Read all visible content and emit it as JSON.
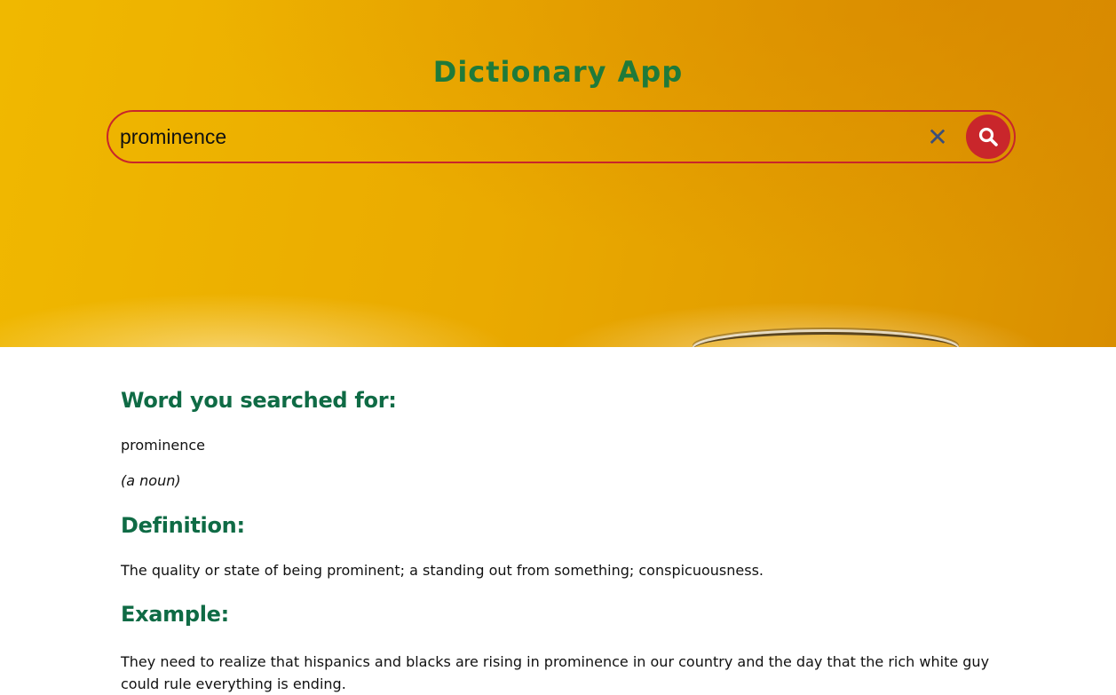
{
  "app": {
    "title": "Dictionary App"
  },
  "search": {
    "value": "prominence",
    "clear_icon": "close-icon",
    "submit_icon": "search-icon"
  },
  "result": {
    "word_heading": "Word you searched for:",
    "word": "prominence",
    "part_of_speech": "(a noun)",
    "definition_heading": "Definition:",
    "definition": "The quality or state of being prominent; a standing out from something; conspicuousness.",
    "example_heading": "Example:",
    "example": "They need to realize that hispanics and blacks are rising in prominence in our country and the day that the rich white guy could rule everything is ending."
  },
  "colors": {
    "accent_red": "#c9262b",
    "title_green": "#1f7a3a",
    "heading_green": "#0f6b45",
    "hero_yellow": "#eaaa00"
  }
}
